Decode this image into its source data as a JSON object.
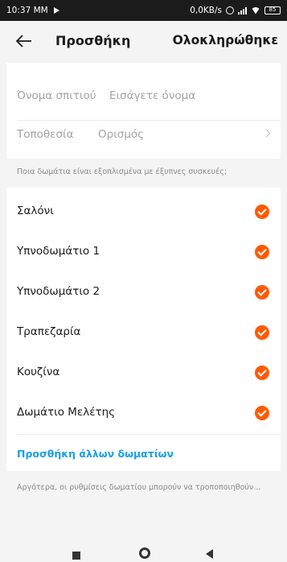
{
  "status_bar": {
    "time": "10:37 MM",
    "data_rate": "0,0KB/s",
    "battery": "85"
  },
  "header": {
    "title": "Προσθήκη",
    "done_label": "Ολοκληρώθηκε",
    "back_icon": "back-arrow-icon"
  },
  "form": {
    "home_name_label": "Όνομα σπιτιού",
    "home_name_placeholder": "Εισάγετε όνομα",
    "location_label": "Τοποθεσία",
    "location_value": "Ορισμός"
  },
  "rooms_question": "Ποια δωμάτια είναι εξοπλισμένα με έξυπνες συσκευές;",
  "rooms": [
    {
      "label": "Σαλόνι",
      "checked": true
    },
    {
      "label": "Υπνοδωμάτιο 1",
      "checked": true
    },
    {
      "label": "Υπνοδωμάτιο 2",
      "checked": true
    },
    {
      "label": "Τραπεζαρία",
      "checked": true
    },
    {
      "label": "Κουζίνα",
      "checked": true
    },
    {
      "label": "Δωμάτιο Μελέτης",
      "checked": true
    }
  ],
  "add_rooms_label": "Προσθήκη άλλων δωματίων",
  "note": "Αργότερα, οι ρυθμίσεις δωματίου μπορούν να τροποποιηθούν...",
  "colors": {
    "accent": "#ff5a00",
    "link": "#1aa1e6"
  }
}
